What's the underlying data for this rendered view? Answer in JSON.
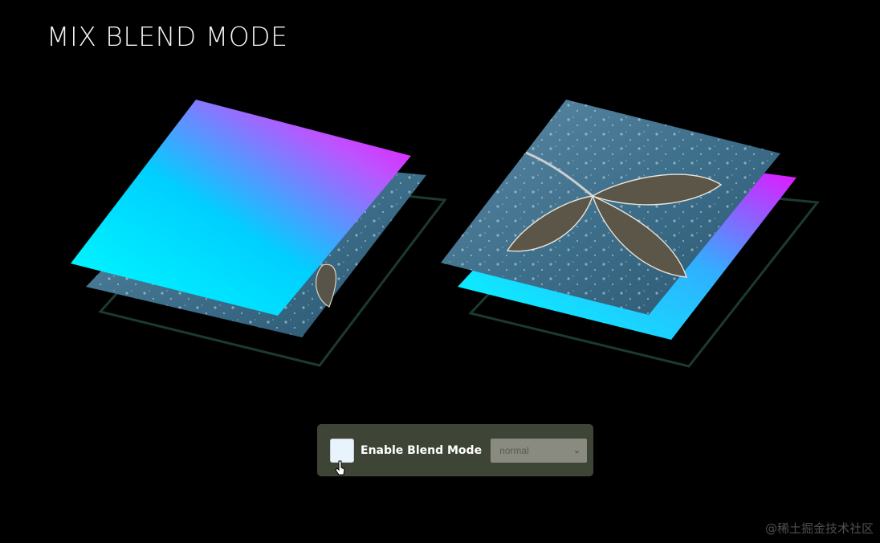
{
  "header": {
    "title": "MIX BLEND MODE"
  },
  "controls": {
    "checkbox_label": "Enable Blend Mode",
    "checkbox_checked": false,
    "blend_select_value": "normal"
  },
  "watermark": {
    "text": "@稀土掘金技术社区"
  },
  "colors": {
    "gradient_start": "#00ffff",
    "gradient_mid": "#00cfff",
    "gradient_end": "#ff00ff",
    "frame_outline": "#1c3a31",
    "panel_bg": "#3f4536",
    "select_bg": "#8a8b80"
  },
  "icons": {
    "select_arrow": "chevron-down-icon",
    "pointer": "hand-cursor-icon"
  }
}
